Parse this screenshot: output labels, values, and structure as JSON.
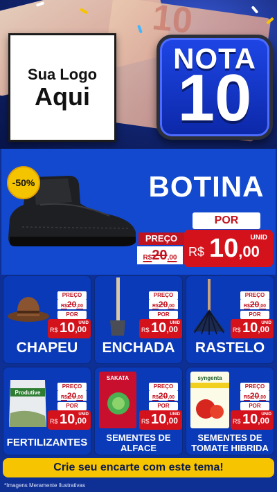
{
  "header": {
    "logo_line1": "Sua Logo",
    "logo_line2": "Aqui",
    "badge_word": "NOTA",
    "badge_number": "10",
    "bill_digits": "10"
  },
  "featured": {
    "discount": "-50%",
    "title": "BOTINA",
    "price_label": "PREÇO",
    "old_price_int": "20",
    "old_price_dec": ",00",
    "old_currency": "R$",
    "por_label": "POR",
    "currency": "R$",
    "new_price_int": "10",
    "new_price_dec": ",00",
    "unit": "UNID"
  },
  "products": [
    {
      "name": "CHAPEU",
      "icon": "hat-icon",
      "price_label": "PREÇO",
      "old_currency": "R$",
      "old_int": "20",
      "old_dec": ",00",
      "por_label": "POR",
      "currency": "R$",
      "new_int": "10",
      "new_dec": ",00",
      "unit": "UNID"
    },
    {
      "name": "ENCHADA",
      "icon": "hoe-icon",
      "price_label": "PREÇO",
      "old_currency": "R$",
      "old_int": "20",
      "old_dec": ",00",
      "por_label": "POR",
      "currency": "R$",
      "new_int": "10",
      "new_dec": ",00",
      "unit": "UNID"
    },
    {
      "name": "RASTELO",
      "icon": "rake-icon",
      "price_label": "PREÇO",
      "old_currency": "R$",
      "old_int": "20",
      "old_dec": ",00",
      "por_label": "POR",
      "currency": "R$",
      "new_int": "10",
      "new_dec": ",00",
      "unit": "UNID"
    },
    {
      "name": "FERTILIZANTES",
      "icon": "fertilizer-bag-icon",
      "pack_text": "Produtive",
      "price_label": "PREÇO",
      "old_currency": "R$",
      "old_int": "20",
      "old_dec": ",00",
      "por_label": "POR",
      "currency": "R$",
      "new_int": "10",
      "new_dec": ",00",
      "unit": "UNID"
    },
    {
      "name_l1": "SEMENTES DE",
      "name_l2": "ALFACE",
      "icon": "seed-packet-icon",
      "pack_text": "SAKATA",
      "price_label": "PREÇO",
      "old_currency": "R$",
      "old_int": "20",
      "old_dec": ",00",
      "por_label": "POR",
      "currency": "R$",
      "new_int": "10",
      "new_dec": ",00",
      "unit": "UNID"
    },
    {
      "name_l1": "SEMENTES DE",
      "name_l2": "TOMATE HIBRIDA",
      "icon": "tomato-seed-packet-icon",
      "pack_text": "syngenta",
      "price_label": "PREÇO",
      "old_currency": "R$",
      "old_int": "20",
      "old_dec": ",00",
      "por_label": "POR",
      "currency": "R$",
      "new_int": "10",
      "new_dec": ",00",
      "unit": "UNID"
    }
  ],
  "footer": {
    "cta": "Crie seu encarte com este tema!",
    "disclaimer": "*Imagens Meramente Ilustrativas"
  },
  "colors": {
    "background": "#0e2f93",
    "card": "#0a3ab8",
    "price_red": "#d4121c",
    "cta_yellow": "#f6c400"
  }
}
